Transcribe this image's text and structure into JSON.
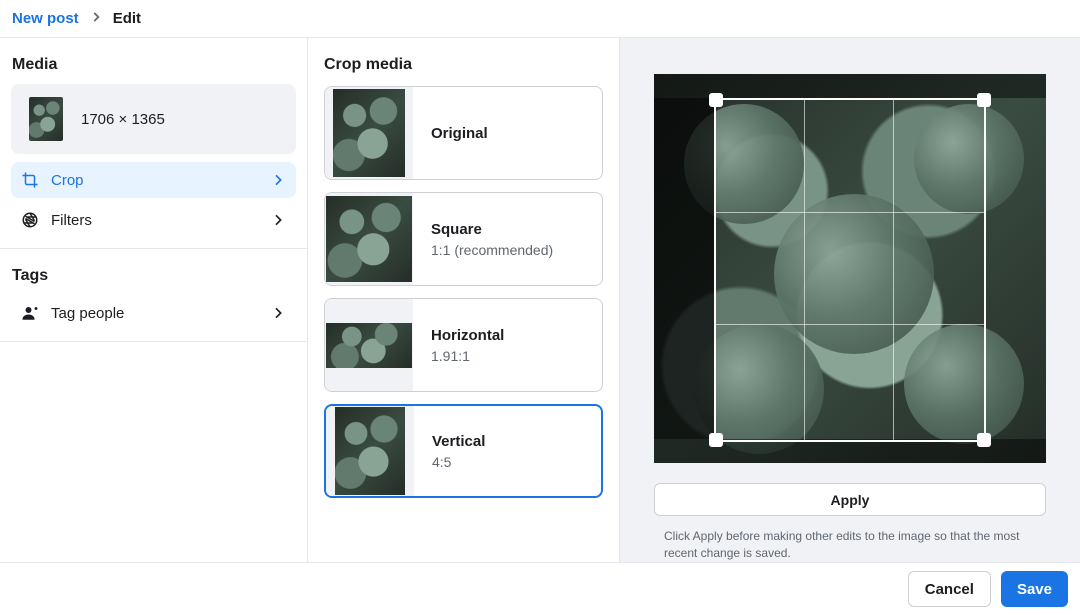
{
  "breadcrumb": {
    "parent": "New post",
    "current": "Edit"
  },
  "sidebar": {
    "media_heading": "Media",
    "media_dimensions": "1706 × 1365",
    "items": [
      {
        "key": "crop",
        "label": "Crop",
        "active": true
      },
      {
        "key": "filters",
        "label": "Filters",
        "active": false
      }
    ],
    "tags_heading": "Tags",
    "tag_people_label": "Tag people"
  },
  "crop": {
    "heading": "Crop media",
    "options": [
      {
        "key": "original",
        "label": "Original",
        "ratio": "",
        "selected": false
      },
      {
        "key": "square",
        "label": "Square",
        "ratio": "1:1 (recommended)",
        "selected": false
      },
      {
        "key": "horizontal",
        "label": "Horizontal",
        "ratio": "1.91:1",
        "selected": false
      },
      {
        "key": "vertical",
        "label": "Vertical",
        "ratio": "4:5",
        "selected": true
      }
    ]
  },
  "preview": {
    "apply_label": "Apply",
    "hint": "Click Apply before making other edits to the image so that the most recent change is saved."
  },
  "footer": {
    "cancel_label": "Cancel",
    "save_label": "Save"
  },
  "colors": {
    "accent": "#1b74e4",
    "border": "#ced0d4",
    "muted_bg": "#f0f2f5"
  }
}
